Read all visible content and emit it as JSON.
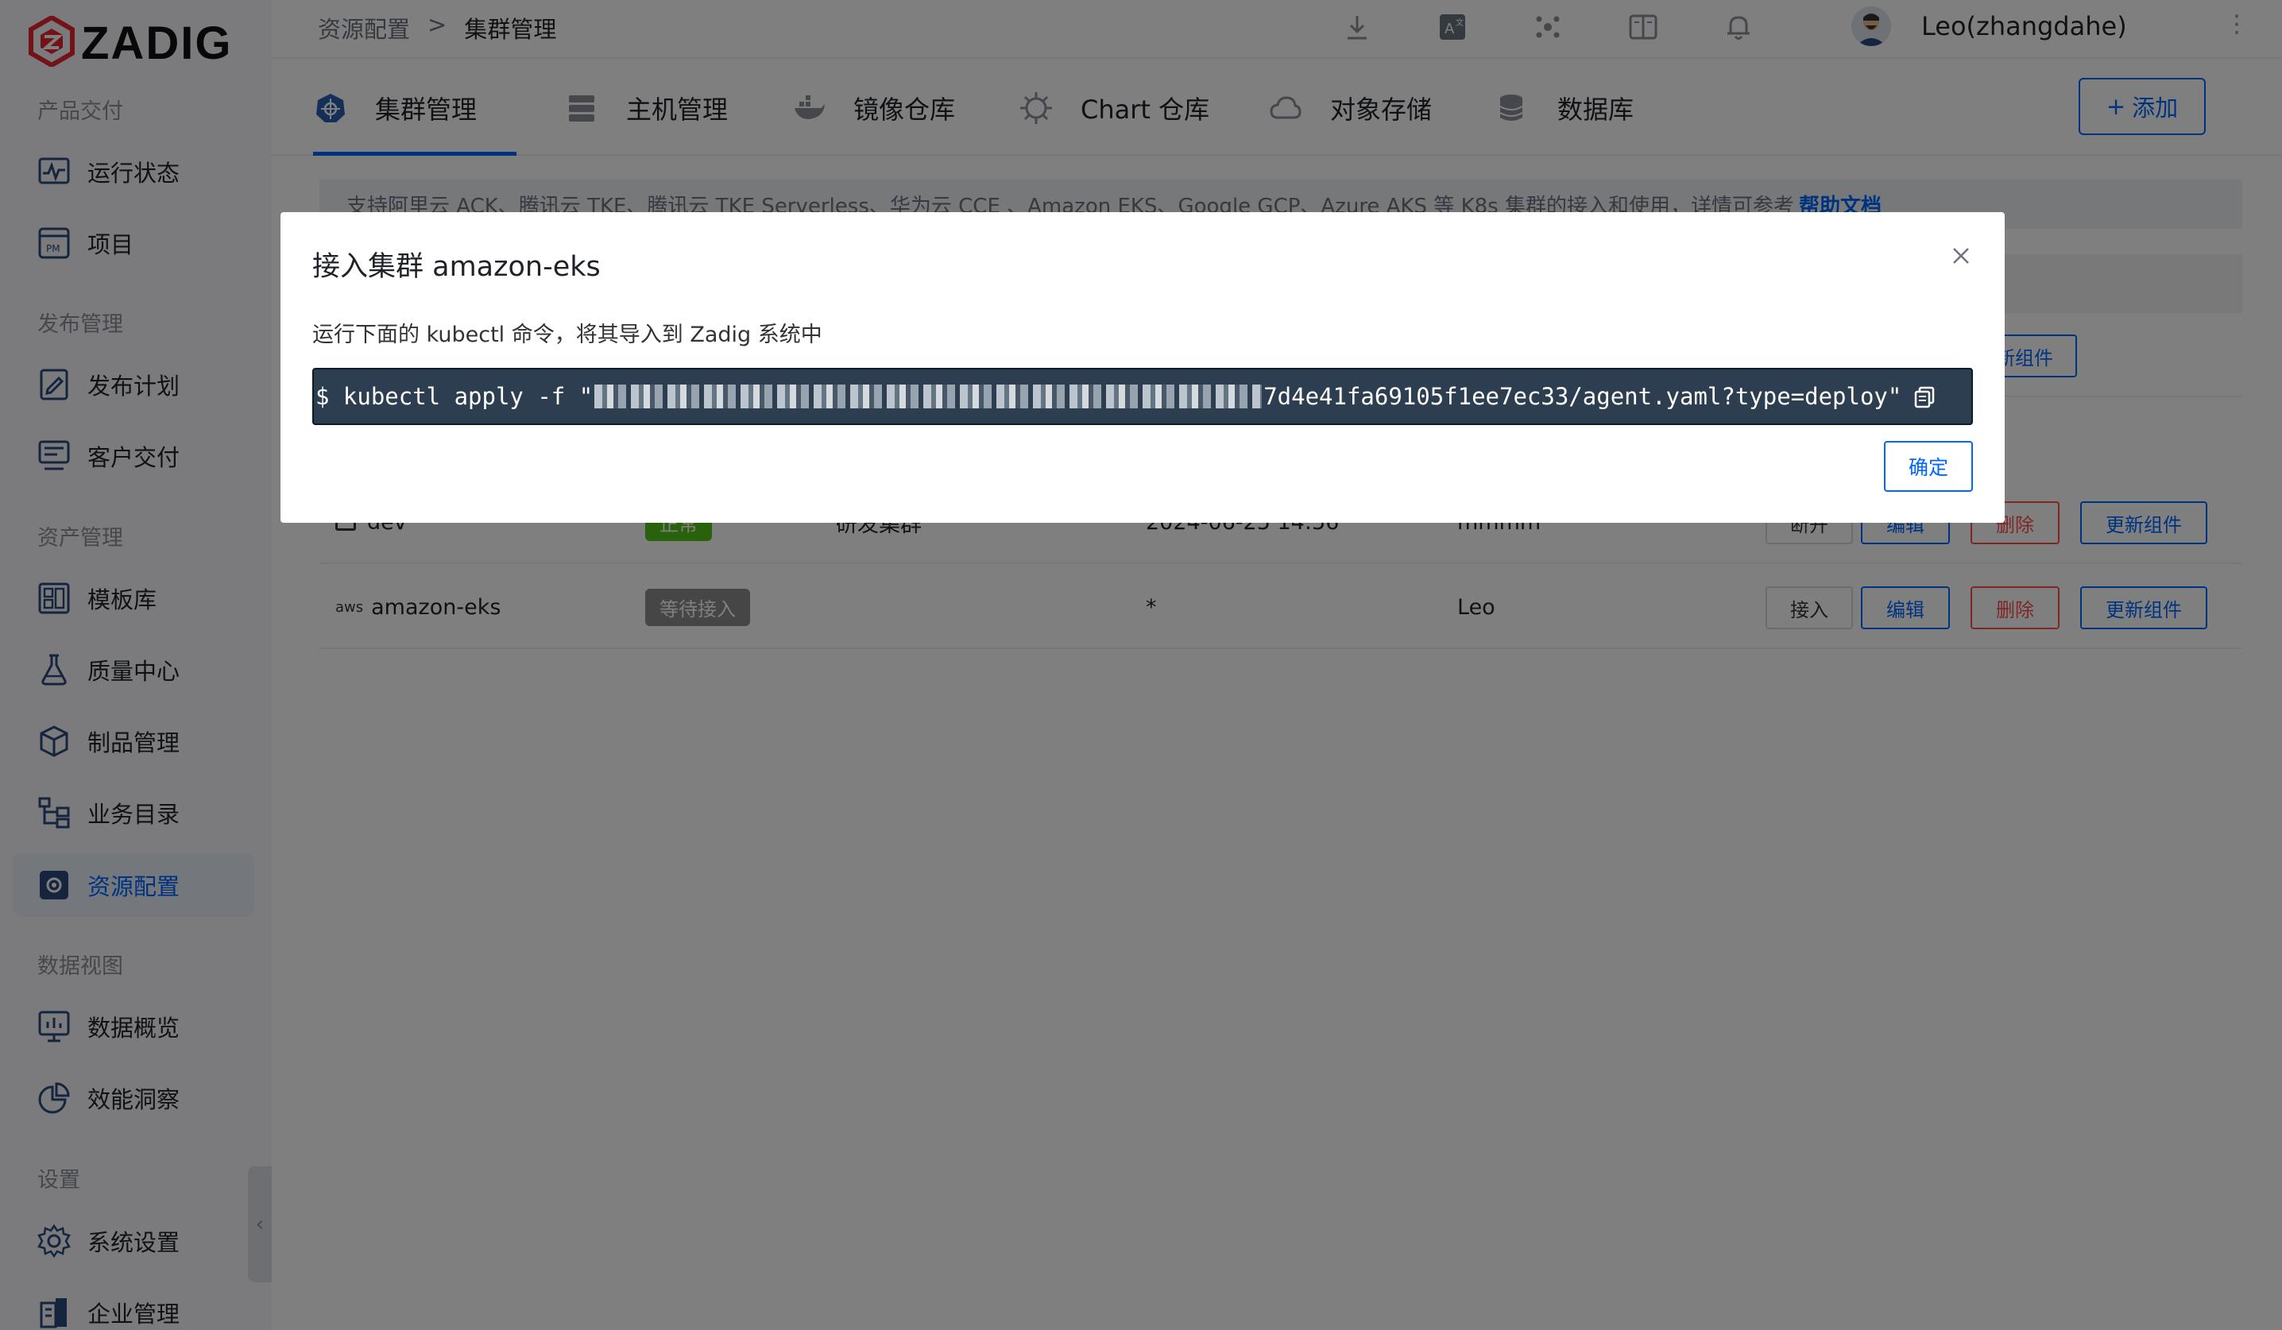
{
  "brand": {
    "name": "ZADIG",
    "accent": "#e6262e"
  },
  "sidebar": {
    "sections": [
      {
        "title": "产品交付",
        "items": [
          {
            "label": "运行状态",
            "icon": "monitor-pulse-icon"
          },
          {
            "label": "项目",
            "icon": "pm-project-icon"
          }
        ]
      },
      {
        "title": "发布管理",
        "items": [
          {
            "label": "发布计划",
            "icon": "release-plan-icon"
          },
          {
            "label": "客户交付",
            "icon": "customer-delivery-icon"
          }
        ]
      },
      {
        "title": "资产管理",
        "items": [
          {
            "label": "模板库",
            "icon": "template-icon"
          },
          {
            "label": "质量中心",
            "icon": "flask-icon"
          },
          {
            "label": "制品管理",
            "icon": "package-icon"
          },
          {
            "label": "业务目录",
            "icon": "tree-icon"
          },
          {
            "label": "资源配置",
            "icon": "resource-gear-icon",
            "active": true
          }
        ]
      },
      {
        "title": "数据视图",
        "items": [
          {
            "label": "数据概览",
            "icon": "chart-board-icon"
          },
          {
            "label": "效能洞察",
            "icon": "pie-chart-icon"
          }
        ]
      },
      {
        "title": "设置",
        "items": [
          {
            "label": "系统设置",
            "icon": "settings-gear-icon"
          },
          {
            "label": "企业管理",
            "icon": "building-icon"
          }
        ]
      }
    ]
  },
  "header": {
    "breadcrumb": [
      "资源配置",
      ">",
      "集群管理"
    ],
    "username": "Leo(zhangdahe)"
  },
  "tabs": [
    {
      "label": "集群管理",
      "active": true
    },
    {
      "label": "主机管理"
    },
    {
      "label": "镜像仓库"
    },
    {
      "label": "Chart 仓库"
    },
    {
      "label": "对象存储"
    },
    {
      "label": "数据库"
    }
  ],
  "add_button": {
    "label": "添加"
  },
  "info_bar": {
    "text": "支持阿里云 ACK、腾讯云 TKE、腾讯云 TKE Serverless、华为云 CCE 、Amazon EKS、Google GCP、Azure AKS 等 K8s 集群的接入和使用，详情可参考",
    "link": "帮助文档"
  },
  "table": {
    "rows": [
      {
        "name": "",
        "status": "",
        "env": "",
        "time": "",
        "owner": "",
        "actions": [
          "更新组件"
        ]
      },
      {
        "name": "dev",
        "status": "正常",
        "status_color": "#52c41a",
        "env": "研发集群",
        "time": "2024-06-25 14:56",
        "owner": "mmmm",
        "actions": [
          "断开",
          "编辑",
          "删除",
          "更新组件"
        ]
      },
      {
        "name": "amazon-eks",
        "status": "等待接入",
        "status_color": "#8c8c8c",
        "env": "*",
        "time": "",
        "owner": "Leo",
        "actions": [
          "接入",
          "编辑",
          "删除",
          "更新组件"
        ]
      }
    ]
  },
  "modal": {
    "title": "接入集群 amazon-eks",
    "description": "运行下面的 kubectl 命令，将其导入到 Zadig 系统中",
    "command_prefix": "$ kubectl apply -f \"",
    "command_suffix": "7d4e41fa69105f1ee7ec33/agent.yaml?type=deploy\"",
    "confirm_label": "确定"
  }
}
